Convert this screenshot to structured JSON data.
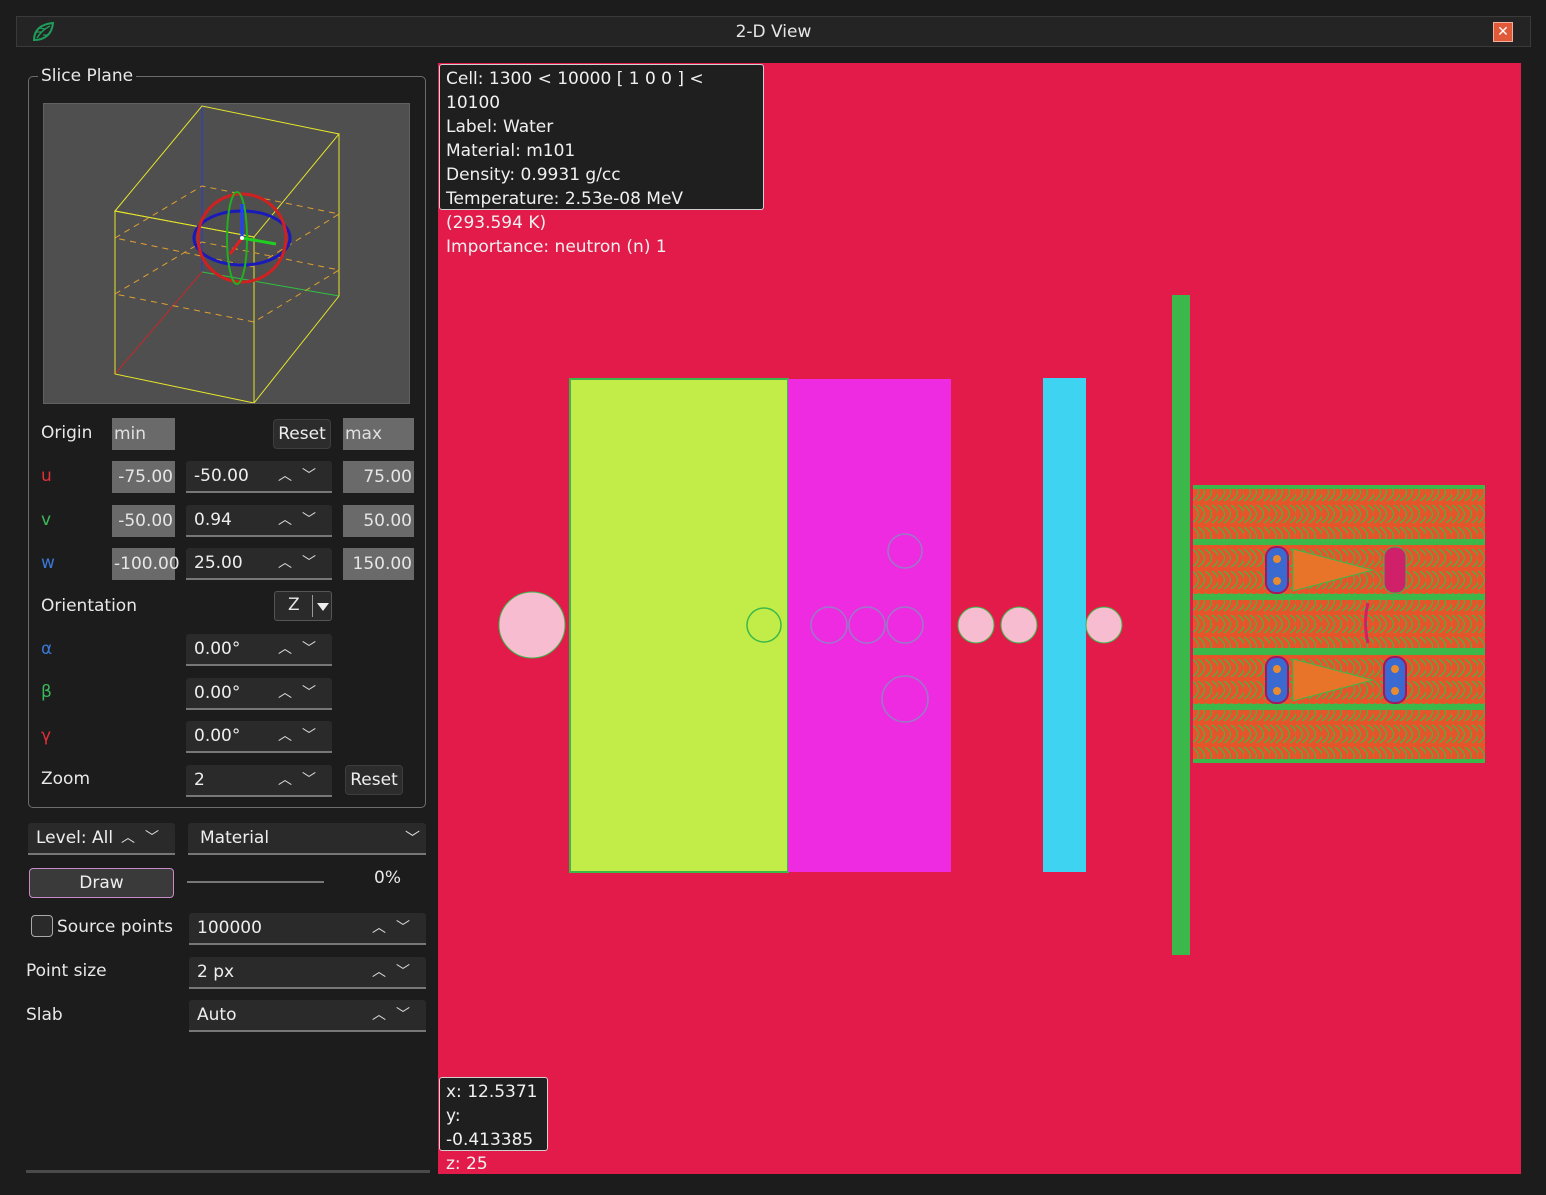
{
  "window": {
    "title": "2-D View",
    "close_glyph": "✕"
  },
  "slice_plane": {
    "title": "Slice Plane",
    "origin_label": "Origin",
    "min_header": "min",
    "max_header": "max",
    "reset_label": "Reset",
    "u": {
      "label": "u",
      "min": "-75.00",
      "value": "-50.00",
      "max": "75.00"
    },
    "v": {
      "label": "v",
      "min": "-50.00",
      "value": "0.94",
      "max": "50.00"
    },
    "w": {
      "label": "w",
      "min": "-100.00",
      "value": "25.00",
      "max": "150.00"
    },
    "orientation_label": "Orientation",
    "orientation_value": "Z",
    "alpha": {
      "label": "α",
      "value": "0.00°"
    },
    "beta": {
      "label": "β",
      "value": "0.00°"
    },
    "gamma": {
      "label": "γ",
      "value": "0.00°"
    },
    "zoom_label": "Zoom",
    "zoom_value": "2",
    "zoom_reset_label": "Reset"
  },
  "controls": {
    "level_value": "Level: All",
    "color_mode": "Material",
    "draw_label": "Draw",
    "progress_text": "0%",
    "progress_fraction": 0,
    "source_points_label": "Source points",
    "source_points_checked": false,
    "source_points_value": "100000",
    "point_size_label": "Point size",
    "point_size_value": "2 px",
    "slab_label": "Slab",
    "slab_value": "Auto"
  },
  "cell_info": {
    "cell": "Cell: 1300 < 10000 [ 1 0 0 ] < 10100",
    "label": "Label: Water",
    "material": "Material: m101",
    "density": "Density: 0.9931 g/cc",
    "temperature": "Temperature: 2.53e-08 MeV (293.594 K)",
    "importance": "Importance: neutron (n) 1"
  },
  "cursor": {
    "x": "x: 12.5371",
    "y": "y: -0.413385",
    "z": "z: 25"
  },
  "colors": {
    "background_material": "#e31b4a",
    "lime_block": "#c2ed48",
    "magenta_block": "#ee2be0",
    "cyan_bar": "#3fd3f2",
    "green_wall": "#3cb84a",
    "pink_sphere": "#f7bcd0",
    "lattice": "#e8542a"
  }
}
